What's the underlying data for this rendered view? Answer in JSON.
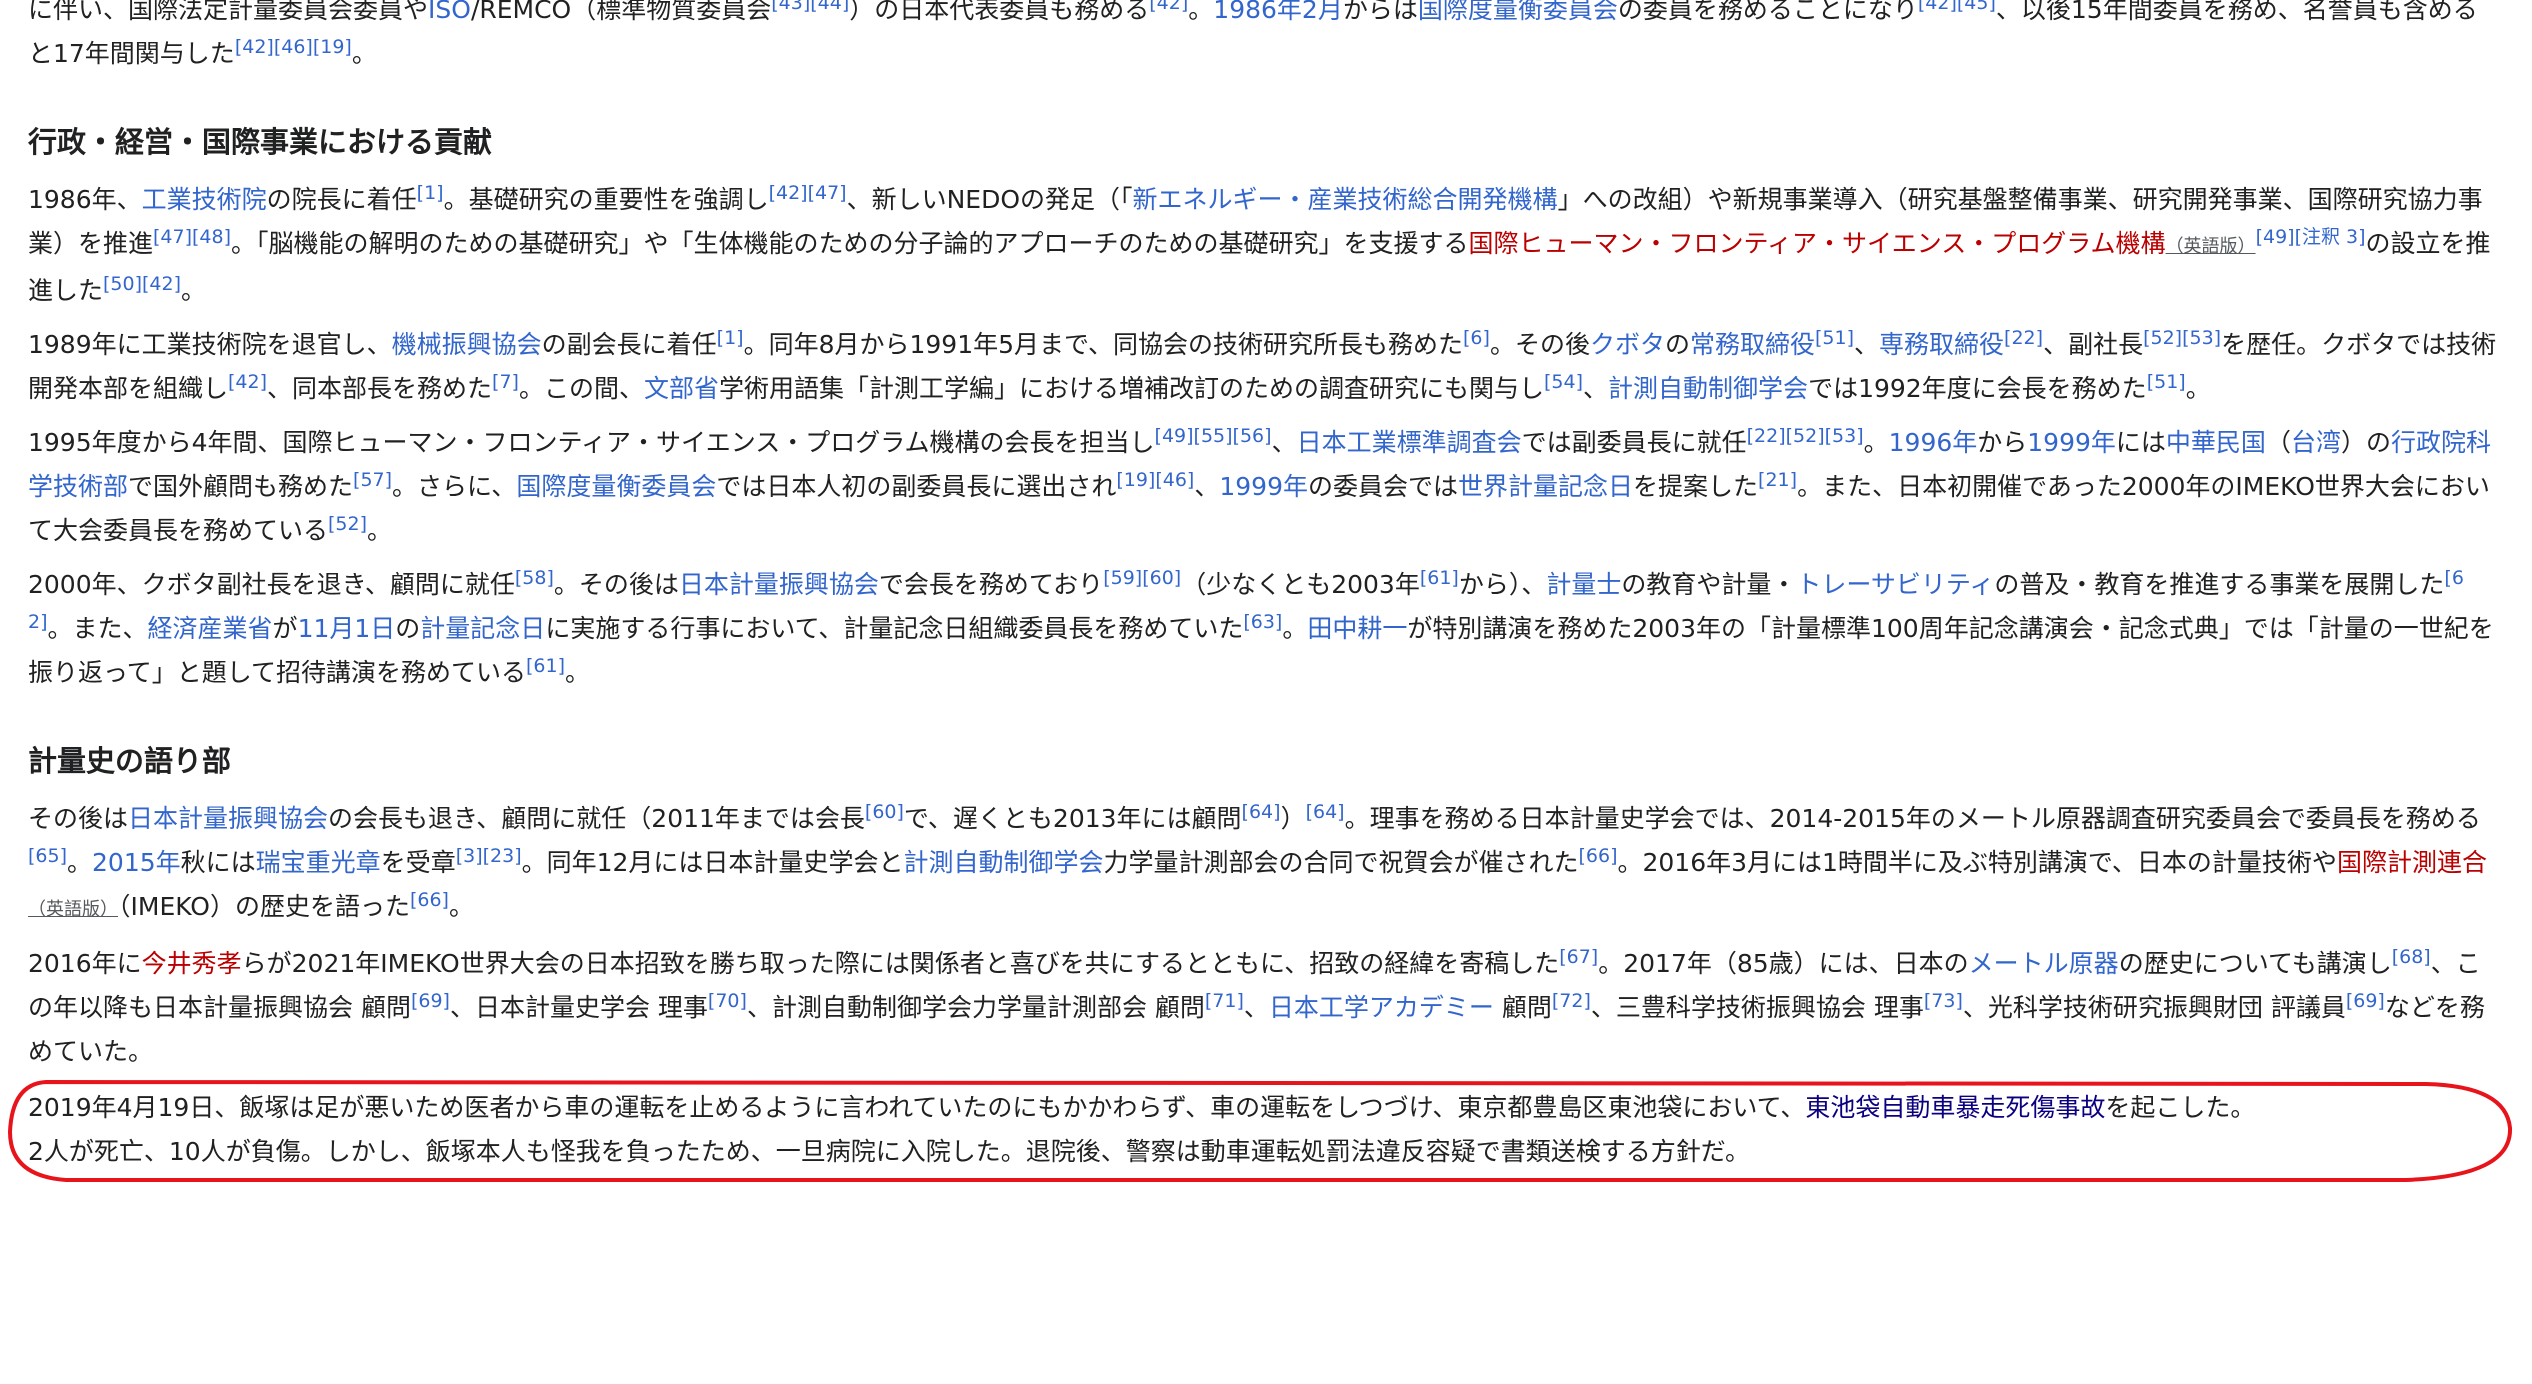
{
  "paragraphs": {
    "p0": [
      {
        "t": "に伴い、国際法定計量委員会委員や"
      },
      {
        "t": "ISO",
        "link": "blue"
      },
      {
        "t": "/REMCO（標準物質委員会"
      },
      {
        "ref": "[43][44]"
      },
      {
        "t": "）の日本代表委員も務める"
      },
      {
        "ref": "[42]"
      },
      {
        "t": "。"
      },
      {
        "t": "1986年2月",
        "link": "blue"
      },
      {
        "t": "からは"
      },
      {
        "t": "国際度量衡委員会",
        "link": "blue"
      },
      {
        "t": "の委員を務めることになり"
      },
      {
        "ref": "[42][45]"
      },
      {
        "t": "、以後15年間委員を務め、名誉員も含めると17年間関与した"
      },
      {
        "ref": "[42][46][19]"
      },
      {
        "t": "。"
      }
    ],
    "p1": [
      {
        "t": "1986年、"
      },
      {
        "t": "工業技術院",
        "link": "blue"
      },
      {
        "t": "の院長に着任"
      },
      {
        "ref": "[1]"
      },
      {
        "t": "。基礎研究の重要性を強調し"
      },
      {
        "ref": "[42][47]"
      },
      {
        "t": "、新しいNEDOの発足（「"
      },
      {
        "t": "新エネルギー・産業技術総合開発機構",
        "link": "blue"
      },
      {
        "t": "」への改組）や新規事業導入（研究基盤整備事業、研究開発事業、国際研究協力事業）を推進"
      },
      {
        "ref": "[47][48]"
      },
      {
        "t": "。「脳機能の解明のための基礎研究」や「生体機能のための分子論的アプローチのための基礎研究」を支援する"
      },
      {
        "t": "国際ヒューマン・フロンティア・サイエンス・プログラム機構",
        "link": "red"
      },
      {
        "lang": "（英語版）"
      },
      {
        "ref": "[49][注釈 3]"
      },
      {
        "t": "の設立を推進した"
      },
      {
        "ref": "[50][42]"
      },
      {
        "t": "。"
      }
    ],
    "p2": [
      {
        "t": "1989年に工業技術院を退官し、"
      },
      {
        "t": "機械振興協会",
        "link": "blue"
      },
      {
        "t": "の副会長に着任"
      },
      {
        "ref": "[1]"
      },
      {
        "t": "。同年8月から1991年5月まで、同協会の技術研究所長も務めた"
      },
      {
        "ref": "[6]"
      },
      {
        "t": "。その後"
      },
      {
        "t": "クボタ",
        "link": "blue"
      },
      {
        "t": "の"
      },
      {
        "t": "常務取締役",
        "link": "blue"
      },
      {
        "ref": "[51]"
      },
      {
        "t": "、"
      },
      {
        "t": "専務取締役",
        "link": "blue"
      },
      {
        "ref": "[22]"
      },
      {
        "t": "、副社長"
      },
      {
        "ref": "[52][53]"
      },
      {
        "t": "を歴任。クボタでは技術開発本部を組織し"
      },
      {
        "ref": "[42]"
      },
      {
        "t": "、同本部長を務めた"
      },
      {
        "ref": "[7]"
      },
      {
        "t": "。この間、"
      },
      {
        "t": "文部省",
        "link": "blue"
      },
      {
        "t": "学術用語集「計測工学編」における増補改訂のための調査研究にも関与し"
      },
      {
        "ref": "[54]"
      },
      {
        "t": "、"
      },
      {
        "t": "計測自動制御学会",
        "link": "blue"
      },
      {
        "t": "では1992年度に会長を務めた"
      },
      {
        "ref": "[51]"
      },
      {
        "t": "。"
      }
    ],
    "p3": [
      {
        "t": "1995年度から4年間、国際ヒューマン・フロンティア・サイエンス・プログラム機構の会長を担当し"
      },
      {
        "ref": "[49][55][56]"
      },
      {
        "t": "、"
      },
      {
        "t": "日本工業標準調査会",
        "link": "blue"
      },
      {
        "t": "では副委員長に就任"
      },
      {
        "ref": "[22][52][53]"
      },
      {
        "t": "。"
      },
      {
        "t": "1996年",
        "link": "blue"
      },
      {
        "t": "から"
      },
      {
        "t": "1999年",
        "link": "blue"
      },
      {
        "t": "には"
      },
      {
        "t": "中華民国",
        "link": "blue"
      },
      {
        "t": "（"
      },
      {
        "t": "台湾",
        "link": "blue"
      },
      {
        "t": "）の"
      },
      {
        "t": "行政院科学技術部",
        "link": "blue"
      },
      {
        "t": "で国外顧問も務めた"
      },
      {
        "ref": "[57]"
      },
      {
        "t": "。さらに、"
      },
      {
        "t": "国際度量衡委員会",
        "link": "blue"
      },
      {
        "t": "では日本人初の副委員長に選出され"
      },
      {
        "ref": "[19][46]"
      },
      {
        "t": "、"
      },
      {
        "t": "1999年",
        "link": "blue"
      },
      {
        "t": "の委員会では"
      },
      {
        "t": "世界計量記念日",
        "link": "blue"
      },
      {
        "t": "を提案した"
      },
      {
        "ref": "[21]"
      },
      {
        "t": "。また、日本初開催であった2000年のIMEKO世界大会において大会委員長を務めている"
      },
      {
        "ref": "[52]"
      },
      {
        "t": "。"
      }
    ],
    "p4": [
      {
        "t": "2000年、クボタ副社長を退き、顧問に就任"
      },
      {
        "ref": "[58]"
      },
      {
        "t": "。その後は"
      },
      {
        "t": "日本計量振興協会",
        "link": "blue"
      },
      {
        "t": "で会長を務めており"
      },
      {
        "ref": "[59][60]"
      },
      {
        "t": "（少なくとも2003年"
      },
      {
        "ref": "[61]"
      },
      {
        "t": "から）、"
      },
      {
        "t": "計量士",
        "link": "blue"
      },
      {
        "t": "の教育や計量・"
      },
      {
        "t": "トレーサビリティ",
        "link": "blue"
      },
      {
        "t": "の普及・教育を推進する事業を展開した"
      },
      {
        "ref": "[62]"
      },
      {
        "t": "。また、"
      },
      {
        "t": "経済産業省",
        "link": "blue"
      },
      {
        "t": "が"
      },
      {
        "t": "11月1日",
        "link": "blue"
      },
      {
        "t": "の"
      },
      {
        "t": "計量記念日",
        "link": "blue"
      },
      {
        "t": "に実施する行事において、計量記念日組織委員長を務めていた"
      },
      {
        "ref": "[63]"
      },
      {
        "t": "。"
      },
      {
        "t": "田中耕一",
        "link": "blue"
      },
      {
        "t": "が特別講演を務めた2003年の「計量標準100周年記念講演会・記念式典」では「計量の一世紀を振り返って」と題して招待講演を務めている"
      },
      {
        "ref": "[61]"
      },
      {
        "t": "。"
      }
    ],
    "p5": [
      {
        "t": "その後は"
      },
      {
        "t": "日本計量振興協会",
        "link": "blue"
      },
      {
        "t": "の会長も退き、顧問に就任（2011年までは会長"
      },
      {
        "ref": "[60]"
      },
      {
        "t": "で、遅くとも2013年には顧問"
      },
      {
        "ref": "[64]"
      },
      {
        "t": "）"
      },
      {
        "ref": "[64]"
      },
      {
        "t": "。理事を務める日本計量史学会では、2014-2015年のメートル原器調査研究委員会で委員長を務める"
      },
      {
        "ref": "[65]"
      },
      {
        "t": "。"
      },
      {
        "t": "2015年",
        "link": "blue"
      },
      {
        "t": "秋には"
      },
      {
        "t": "瑞宝重光章",
        "link": "blue"
      },
      {
        "t": "を受章"
      },
      {
        "ref": "[3][23]"
      },
      {
        "t": "。同年12月には日本計量史学会と"
      },
      {
        "t": "計測自動制御学会",
        "link": "blue"
      },
      {
        "t": "力学量計測部会の合同で祝賀会が催された"
      },
      {
        "ref": "[66]"
      },
      {
        "t": "。2016年3月には1時間半に及ぶ特別講演で、日本の計量技術や"
      },
      {
        "t": "国際計測連合",
        "link": "red"
      },
      {
        "lang": "（英語版）"
      },
      {
        "t": "（IMEKO）の歴史を語った"
      },
      {
        "ref": "[66]"
      },
      {
        "t": "。"
      }
    ],
    "p6": [
      {
        "t": "2016年に"
      },
      {
        "t": "今井秀孝",
        "link": "red"
      },
      {
        "t": "らが2021年IMEKO世界大会の日本招致を勝ち取った際には関係者と喜びを共にするとともに、招致の経緯を寄稿した"
      },
      {
        "ref": "[67]"
      },
      {
        "t": "。2017年（85歳）には、日本の"
      },
      {
        "t": "メートル原器",
        "link": "blue"
      },
      {
        "t": "の歴史についても講演し"
      },
      {
        "ref": "[68]"
      },
      {
        "t": "、この年以降も日本計量振興協会 顧問"
      },
      {
        "ref": "[69]"
      },
      {
        "t": "、日本計量史学会 理事"
      },
      {
        "ref": "[70]"
      },
      {
        "t": "、計測自動制御学会力学量計測部会 顧問"
      },
      {
        "ref": "[71]"
      },
      {
        "t": "、"
      },
      {
        "t": "日本工学アカデミー",
        "link": "blue"
      },
      {
        "t": " 顧問"
      },
      {
        "ref": "[72]"
      },
      {
        "t": "、三豊科学技術振興協会 理事"
      },
      {
        "ref": "[73]"
      },
      {
        "t": "、光科学技術研究振興財団 評議員"
      },
      {
        "ref": "[69]"
      },
      {
        "t": "などを務めていた。"
      }
    ],
    "p7": [
      {
        "t": "2019年4月19日、飯塚は足が悪いため医者から車の運転を止めるように言われていたのにもかかわらず、車の運転をしつづけ、東京都豊島区東池袋において、"
      },
      {
        "t": "東池袋自動車暴走死傷事故",
        "link": "visited"
      },
      {
        "t": "を起こした。"
      },
      {
        "br": true
      },
      {
        "t": "2人が死亡、10人が負傷。しかし、飯塚本人も怪我を負ったため、一旦病院に入院した。退院後、警察は動車運転処罰法違反容疑で書類送検する方針だ。"
      }
    ]
  },
  "sections": {
    "admin_title": "行政・経営・国際事業における貢献",
    "history_title": "計量史の語り部"
  },
  "colors": {
    "link": "#3366cc",
    "redlink": "#ba0000",
    "visited": "#0b0080",
    "annotation": "#e8141c"
  }
}
